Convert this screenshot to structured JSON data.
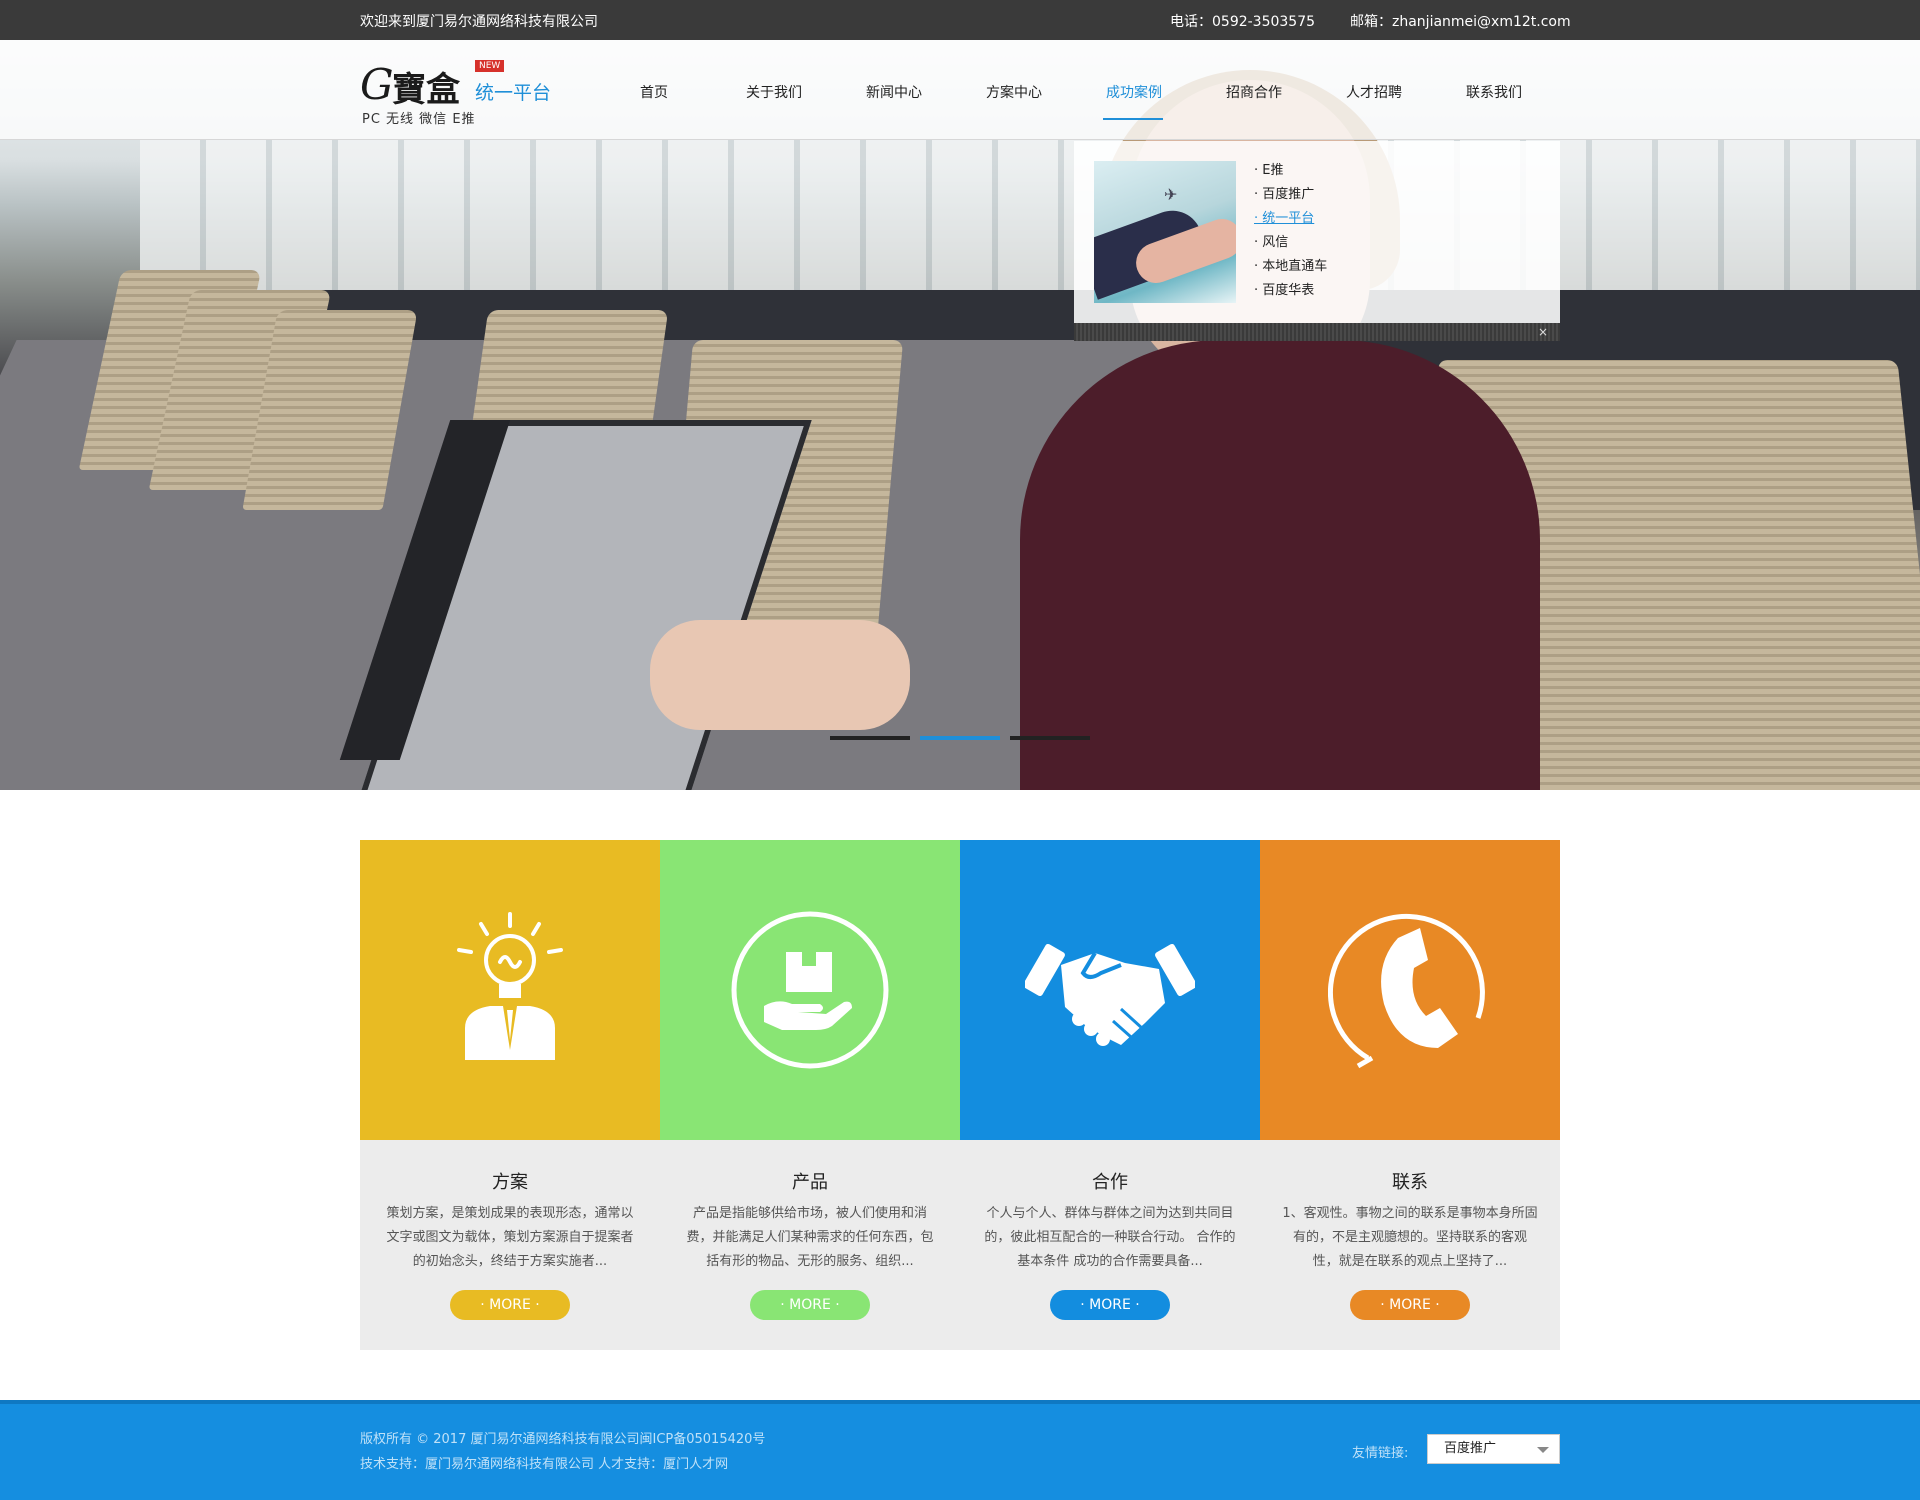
{
  "topbar": {
    "welcome": "欢迎来到厦门易尔通网络科技有限公司",
    "phone": "电话：0592-3503575",
    "email": "邮箱：zhanjianmei@xm12t.com"
  },
  "logo": {
    "g_letter": "G",
    "cn_name": "寶盒",
    "new_badge": "NEW",
    "title": "统一平台",
    "subtitle": "PC 无线  微信  E推"
  },
  "nav": {
    "items": [
      {
        "label": "首页"
      },
      {
        "label": "关于我们"
      },
      {
        "label": "新闻中心"
      },
      {
        "label": "方案中心"
      },
      {
        "label": "成功案例",
        "active": true
      },
      {
        "label": "招商合作"
      },
      {
        "label": "人才招聘"
      },
      {
        "label": "联系我们"
      }
    ]
  },
  "dropdown": {
    "links": [
      "· E推",
      "· 百度推广",
      "· 统一平台",
      "· 风信",
      "· 本地直通车",
      "· 百度华表"
    ],
    "active_index": 2,
    "close": "×"
  },
  "cards": [
    {
      "title": "方案",
      "desc": "策划方案，是策划成果的表现形态，通常以文字或图文为载体，策划方案源自于提案者的初始念头，终结于方案实施者...",
      "more": "· MORE ·",
      "color": "#e8bb23",
      "btn_color": "#e8bb23",
      "icon": "lightbulb-person-icon"
    },
    {
      "title": "产品",
      "desc": "产品是指能够供给市场，被人们使用和消费，并能满足人们某种需求的任何东西，包括有形的物品、无形的服务、组织...",
      "more": "· MORE ·",
      "color": "#89e574",
      "btn_color": "#89e574",
      "icon": "box-in-hand-icon"
    },
    {
      "title": "合作",
      "desc": "个人与个人、群体与群体之间为达到共同目的，彼此相互配合的一种联合行动。 合作的基本条件 成功的合作需要具备...",
      "more": "· MORE ·",
      "color": "#138ddf",
      "btn_color": "#138ddf",
      "icon": "handshake-icon"
    },
    {
      "title": "联系",
      "desc": "1、客观性。事物之间的联系是事物本身所固有的，不是主观臆想的。坚持联系的客观性，就是在联系的观点上坚持了...",
      "more": "· MORE ·",
      "color": "#e88925",
      "btn_color": "#e88925",
      "icon": "phone-handset-icon"
    }
  ],
  "footer": {
    "copyright": "版权所有 © 2017 厦门易尔通网络科技有限公司闽ICP备05015420号",
    "support": "技术支持：厦门易尔通网络科技有限公司  人才支持：厦门人才网",
    "friend_label": "友情链接:",
    "friend_selected": "百度推广"
  },
  "colors": {
    "accent": "#1f8fd8",
    "footer_bg": "#158ee0",
    "topbar_bg": "#3a3a3a"
  }
}
